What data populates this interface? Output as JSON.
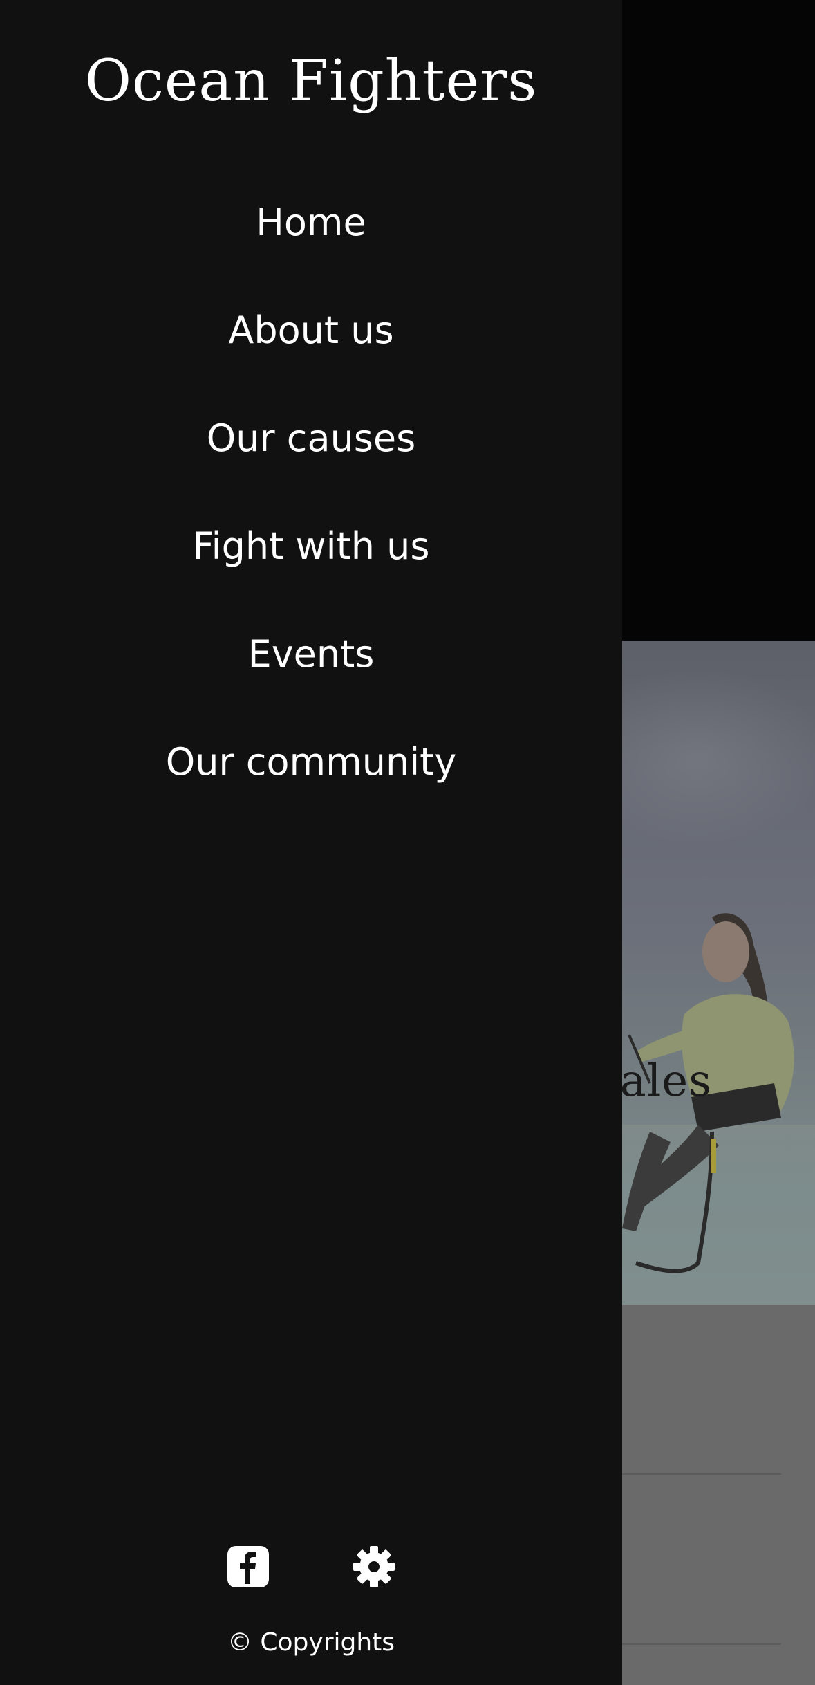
{
  "drawer": {
    "brand": "Ocean Fighters",
    "nav": [
      {
        "label": "Home"
      },
      {
        "label": "About us"
      },
      {
        "label": "Our causes"
      },
      {
        "label": "Fight with us"
      },
      {
        "label": "Events"
      },
      {
        "label": "Our community"
      }
    ],
    "footer": {
      "icons": [
        "facebook-icon",
        "gear-icon"
      ],
      "copyright": "© Copyrights"
    }
  },
  "background_page": {
    "hero_title_fragment": "hales"
  },
  "colors": {
    "drawer_bg": "#111111",
    "drawer_text": "#ffffff",
    "overlay_bg": "#050505"
  }
}
